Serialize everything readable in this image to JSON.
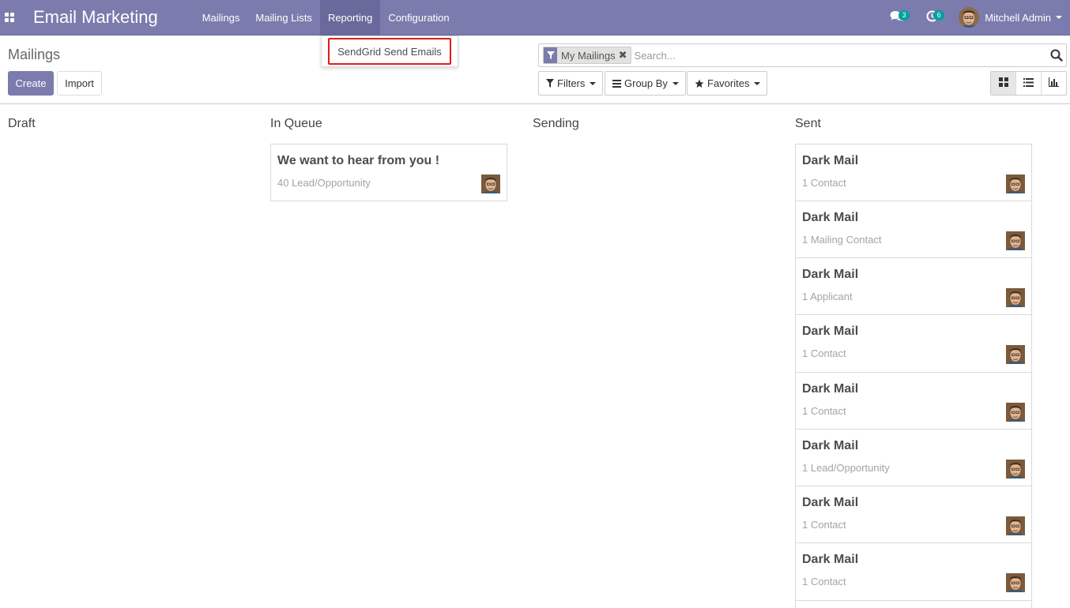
{
  "navbar": {
    "app_title": "Email Marketing",
    "menu": [
      {
        "label": "Mailings"
      },
      {
        "label": "Mailing Lists"
      },
      {
        "label": "Reporting"
      },
      {
        "label": "Configuration"
      }
    ],
    "messages_count": "3",
    "activities_count": "6",
    "user_name": "Mitchell Admin"
  },
  "reporting_dropdown": {
    "items": [
      {
        "label": "SendGrid Send Emails"
      }
    ]
  },
  "control_panel": {
    "breadcrumb": "Mailings",
    "create_label": "Create",
    "import_label": "Import",
    "search": {
      "facet": "My Mailings",
      "placeholder": "Search..."
    },
    "filters_label": "Filters",
    "group_by_label": "Group By",
    "favorites_label": "Favorites"
  },
  "kanban": {
    "columns": [
      {
        "title": "Draft",
        "cards": []
      },
      {
        "title": "In Queue",
        "cards": [
          {
            "title": "We want to hear from you !",
            "subtitle": "40 Lead/Opportunity"
          }
        ]
      },
      {
        "title": "Sending",
        "cards": []
      },
      {
        "title": "Sent",
        "cards": [
          {
            "title": "Dark Mail",
            "subtitle": "1 Contact"
          },
          {
            "title": "Dark Mail",
            "subtitle": "1 Mailing Contact"
          },
          {
            "title": "Dark Mail",
            "subtitle": "1 Applicant"
          },
          {
            "title": "Dark Mail",
            "subtitle": "1 Contact"
          },
          {
            "title": "Dark Mail",
            "subtitle": "1 Contact"
          },
          {
            "title": "Dark Mail",
            "subtitle": "1 Lead/Opportunity"
          },
          {
            "title": "Dark Mail",
            "subtitle": "1 Contact"
          },
          {
            "title": "Dark Mail",
            "subtitle": "1 Contact"
          }
        ]
      }
    ]
  },
  "colors": {
    "brand": "#7c7bad",
    "badge": "#00a09d",
    "highlight": "#e01b1b"
  }
}
